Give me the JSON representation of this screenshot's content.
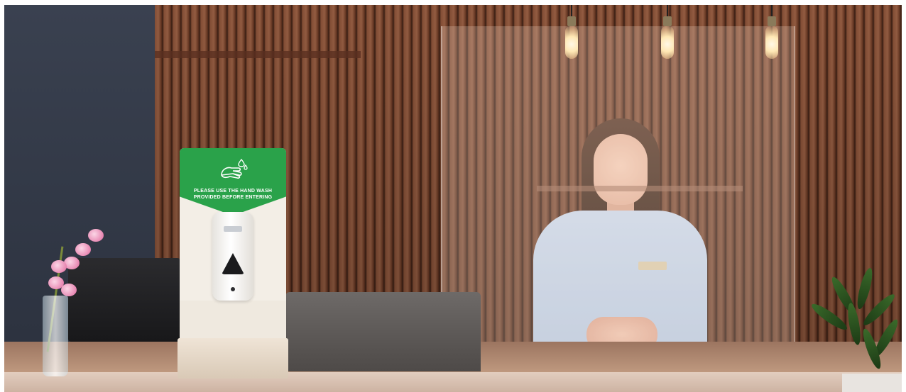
{
  "scene": {
    "description_role": "photo",
    "sign": {
      "line1": "PLEASE USE THE HAND WASH",
      "line2": "PROVIDED BEFORE ENTERING",
      "icon": "hand-wash-icon",
      "color": "#2aa24a"
    }
  }
}
